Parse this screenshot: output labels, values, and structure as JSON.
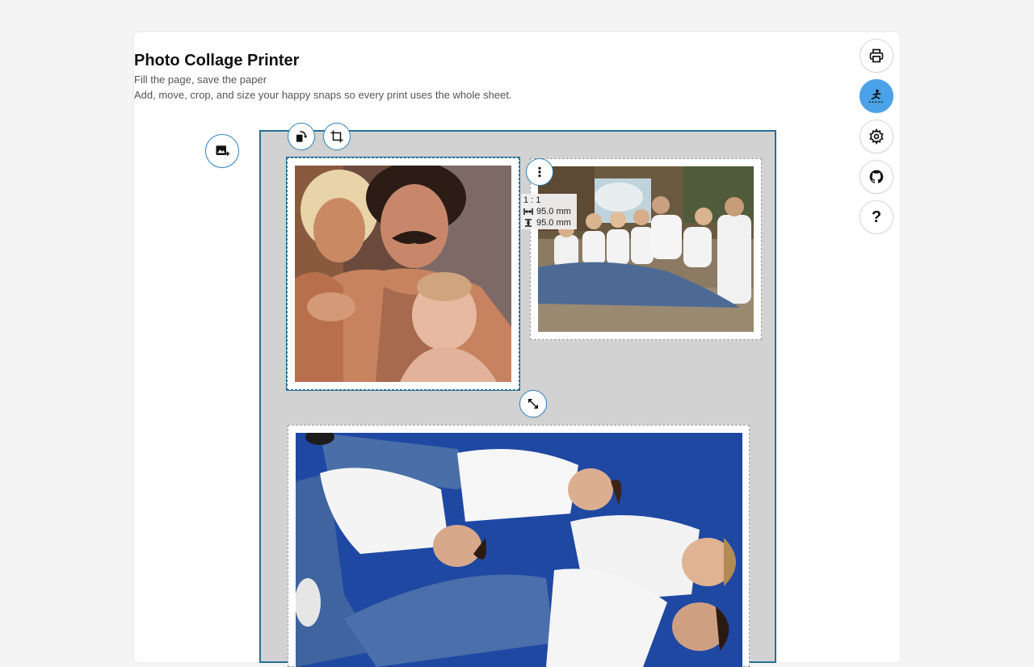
{
  "app": {
    "title": "Photo Collage Printer",
    "subtitle": "Fill the page, save the paper",
    "description": "Add, move, crop, and size your happy snaps so every print uses the whole sheet."
  },
  "sidebar": {
    "buttons": [
      {
        "name": "print-button",
        "icon": "printer-icon"
      },
      {
        "name": "auto-layout-button",
        "icon": "cutting-icon",
        "active": true
      },
      {
        "name": "settings-button",
        "icon": "gear-icon"
      },
      {
        "name": "github-button",
        "icon": "github-icon"
      },
      {
        "name": "help-button",
        "icon": "question-icon",
        "label": "?"
      }
    ]
  },
  "selected_photo_info": {
    "ratio": "1 : 1",
    "width": "95.0 mm",
    "height": "95.0 mm"
  },
  "colors": {
    "accent": "#2a6f97",
    "active_button": "#4aa3e8",
    "page_background": "#d2d2d2"
  }
}
